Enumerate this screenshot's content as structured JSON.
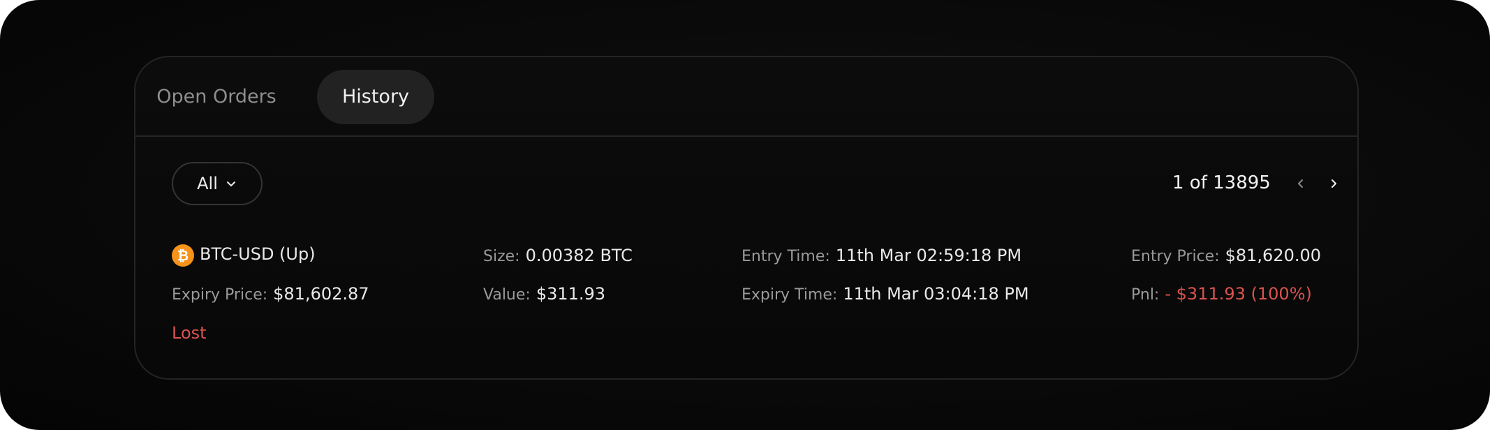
{
  "tabs": {
    "open_orders": "Open Orders",
    "history": "History",
    "active": "History"
  },
  "filter": {
    "selected": "All"
  },
  "pagination": {
    "text": "1 of 13895"
  },
  "order": {
    "asset_icon": "bitcoin-icon",
    "asset_symbol": "₿",
    "pair": "BTC-USD (Up)",
    "size_label": "Size:",
    "size_value": "0.00382 BTC",
    "entry_time_label": "Entry Time:",
    "entry_time_value": "11th Mar 02:59:18 PM",
    "entry_price_label": "Entry Price:",
    "entry_price_value": "$81,620.00",
    "expiry_price_label": "Expiry Price:",
    "expiry_price_value": "$81,602.87",
    "value_label": "Value:",
    "value_value": "$311.93",
    "expiry_time_label": "Expiry Time:",
    "expiry_time_value": "11th Mar 03:04:18 PM",
    "pnl_label": "Pnl:",
    "pnl_value": "- $311.93 (100%)",
    "status": "Lost"
  },
  "colors": {
    "negative": "#d9534f",
    "bitcoin": "#f7931a",
    "active_tab_bg": "#222222"
  }
}
